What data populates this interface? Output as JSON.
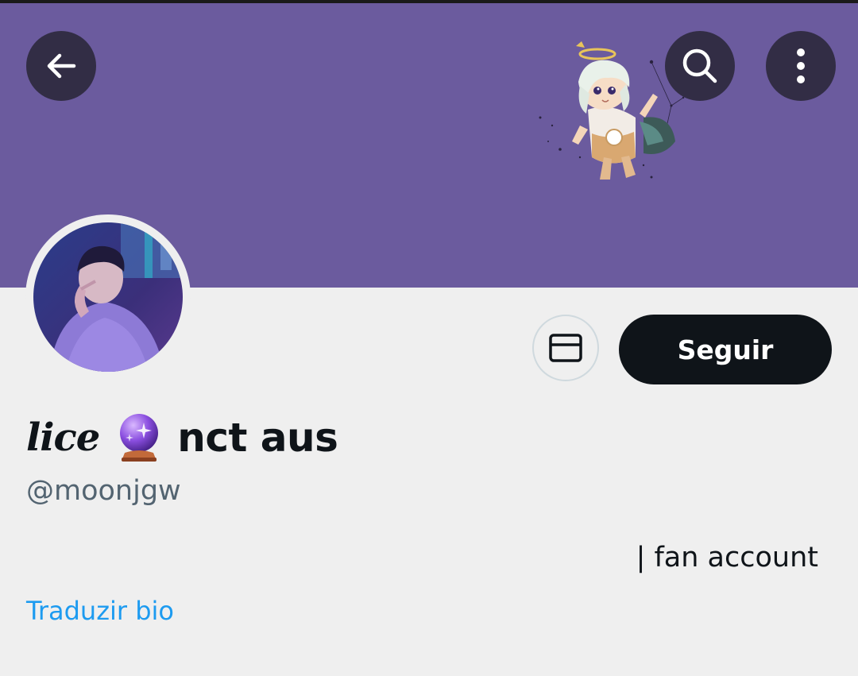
{
  "header": {
    "back_icon": "arrow-left-icon",
    "search_icon": "search-icon",
    "more_icon": "more-vertical-icon",
    "banner_color": "#6b5b9e"
  },
  "profile": {
    "name_script": "lice",
    "name_emoji": "crystal-ball",
    "name_rest": "nct aus",
    "handle": "@moonjgw",
    "bio": "| fan account",
    "translate_label": "Traduzir bio"
  },
  "actions": {
    "message_icon": "envelope-icon",
    "follow_label": "Seguir"
  },
  "colors": {
    "accent_link": "#1d9bf0",
    "follow_bg": "#0f1419",
    "secondary_text": "#536471"
  }
}
